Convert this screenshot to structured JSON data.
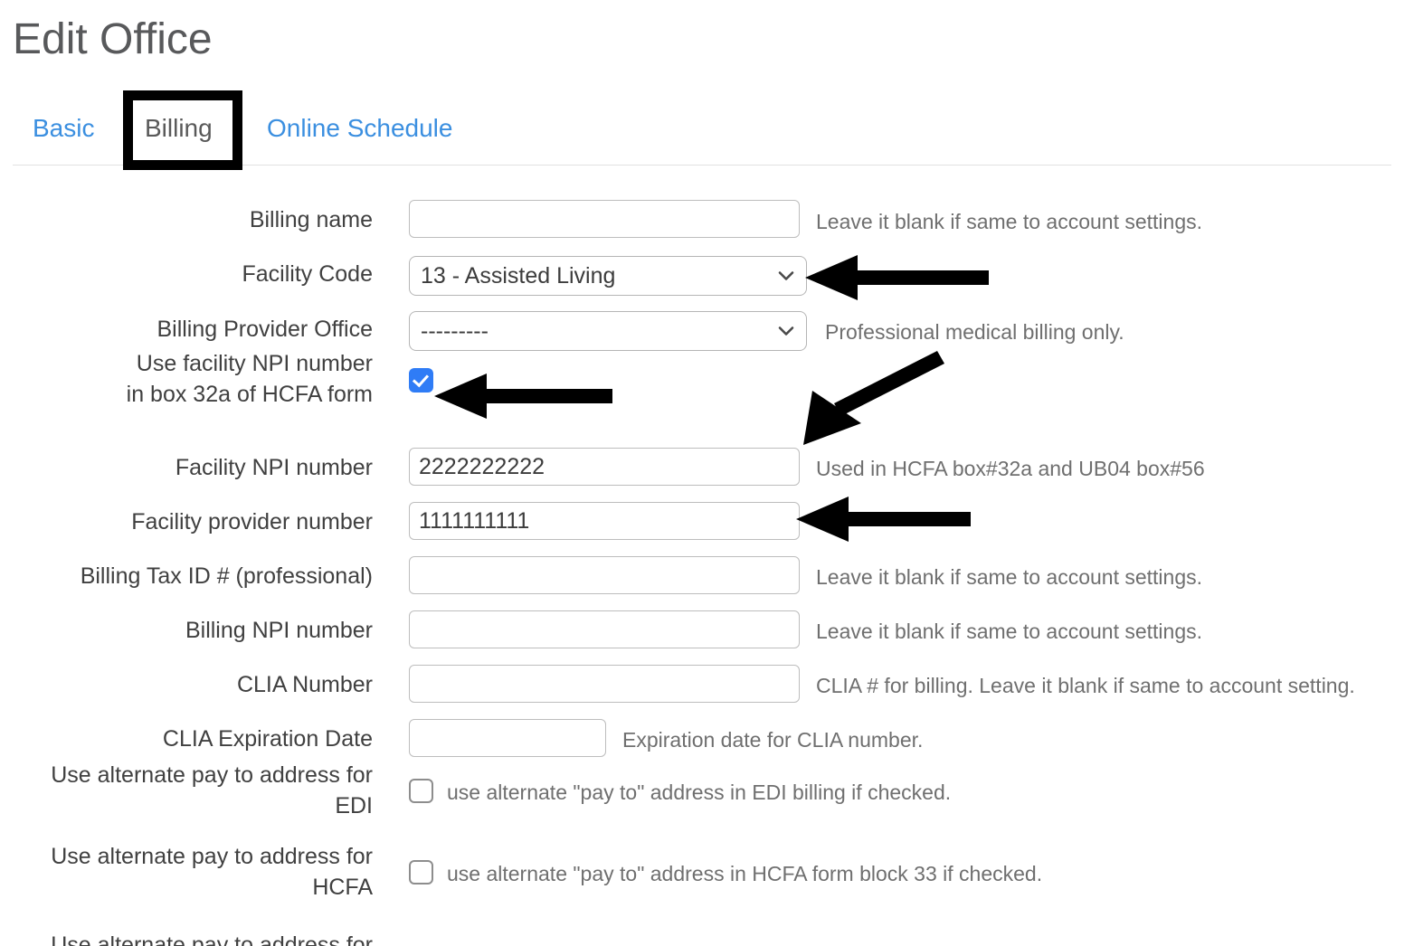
{
  "page": {
    "title": "Edit Office"
  },
  "tabs": [
    {
      "label": "Basic",
      "active": false
    },
    {
      "label": "Billing",
      "active": true
    },
    {
      "label": "Online Schedule",
      "active": false
    }
  ],
  "form": {
    "rows": [
      {
        "label": "Billing name",
        "type": "text",
        "value": "",
        "help": "Leave it blank if same to account settings."
      },
      {
        "label": "Facility Code",
        "type": "select",
        "value": "13 - Assisted Living",
        "help": ""
      },
      {
        "label": "Billing Provider Office",
        "type": "select",
        "value": "---------",
        "help": "Professional medical billing only."
      },
      {
        "label": "Use facility NPI number\nin box 32a of HCFA form",
        "type": "checkbox",
        "checked": true,
        "help": ""
      },
      {
        "label": "Facility NPI number",
        "type": "text",
        "value": "2222222222",
        "help": "Used in HCFA box#32a and UB04 box#56"
      },
      {
        "label": "Facility provider number",
        "type": "text",
        "value": "1111111111",
        "help": ""
      },
      {
        "label": "Billing Tax ID # (professional)",
        "type": "text",
        "value": "",
        "help": "Leave it blank if same to account settings."
      },
      {
        "label": "Billing NPI number",
        "type": "text",
        "value": "",
        "help": "Leave it blank if same to account settings."
      },
      {
        "label": "CLIA Number",
        "type": "text",
        "value": "",
        "help": "CLIA # for billing. Leave it blank if same to account setting."
      },
      {
        "label": "CLIA Expiration Date",
        "type": "text-small",
        "value": "",
        "help": "Expiration date for CLIA number."
      },
      {
        "label": "Use alternate pay to address for\nEDI",
        "type": "checkbox-inline",
        "checked": false,
        "help": "use alternate \"pay to\" address in EDI billing if checked."
      },
      {
        "label": "Use alternate pay to address for\nHCFA",
        "type": "checkbox-inline",
        "checked": false,
        "help": "use alternate \"pay to\" address in HCFA form block 33 if checked."
      }
    ],
    "cutoff_row_label": "Use alternate pay to address for"
  },
  "annotations": {
    "highlight_target": "Billing",
    "arrows": [
      {
        "name": "arrow-facility-code",
        "direction": "left"
      },
      {
        "name": "arrow-use-facility-npi",
        "direction": "left"
      },
      {
        "name": "arrow-facility-npi-number",
        "direction": "diagonal-down-left"
      },
      {
        "name": "arrow-facility-provider",
        "direction": "left"
      }
    ]
  },
  "colors": {
    "link": "#3b8fe0",
    "text": "#404040",
    "help": "#6f6f6f",
    "checkbox_checked": "#2f7cf6",
    "annotation": "#000000",
    "border": "#bdbdbd"
  }
}
